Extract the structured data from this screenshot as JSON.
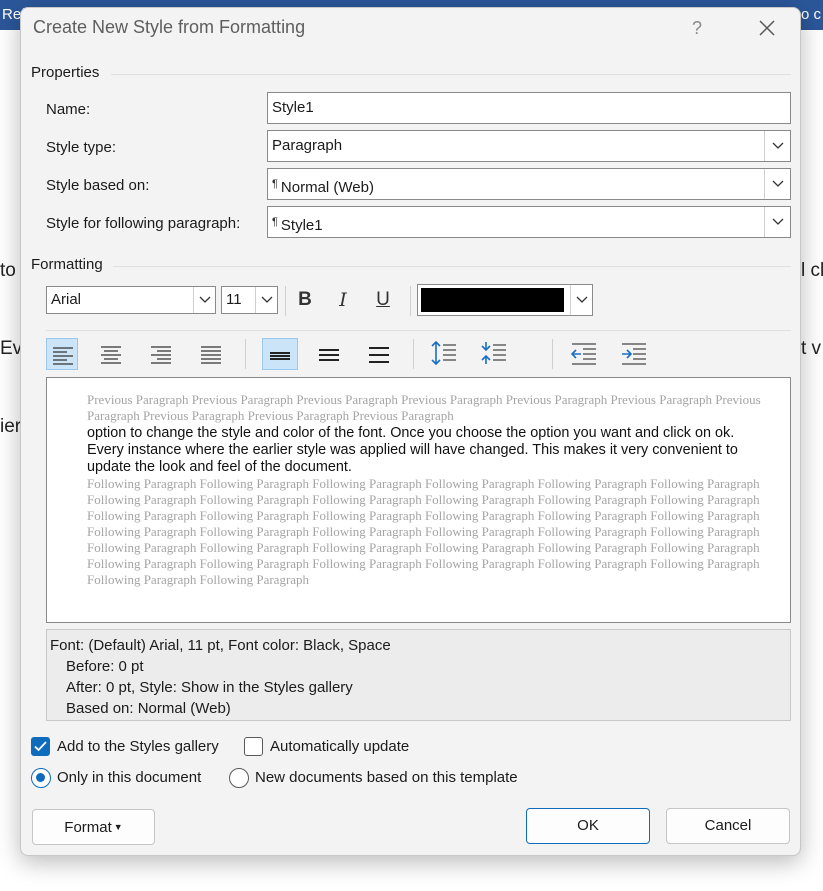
{
  "background": {
    "ribbon_left": "Ref",
    "ribbon_right": "o c",
    "side_left": [
      "to",
      "Ev",
      "ier"
    ],
    "side_right": [
      "l cl",
      "t v"
    ]
  },
  "dialog": {
    "title": "Create New Style from Formatting",
    "help": "?",
    "properties_label": "Properties",
    "name_label": "Name:",
    "name_value": "Style1",
    "style_type_label": "Style type:",
    "style_type_value": "Paragraph",
    "based_on_label": "Style based on:",
    "based_on_value": "Normal (Web)",
    "following_label": "Style for following paragraph:",
    "following_value": "Style1",
    "formatting_label": "Formatting",
    "font_name": "Arial",
    "font_size": "11",
    "bold": "B",
    "italic": "I",
    "underline": "U",
    "font_color": "#000000",
    "preview": {
      "previous": "Previous Paragraph Previous Paragraph Previous Paragraph Previous Paragraph Previous Paragraph Previous Paragraph Previous Paragraph Previous Paragraph Previous Paragraph Previous Paragraph",
      "main": "option to change the style and color of the font. Once you choose the option you want and click on ok. Every instance where the earlier style was applied will have changed. This makes it very convenient to update the look and feel of the document.",
      "following": "Following Paragraph Following Paragraph Following Paragraph Following Paragraph Following Paragraph Following Paragraph Following Paragraph Following Paragraph Following Paragraph Following Paragraph Following Paragraph Following Paragraph Following Paragraph Following Paragraph Following Paragraph Following Paragraph Following Paragraph Following Paragraph Following Paragraph Following Paragraph Following Paragraph Following Paragraph Following Paragraph Following Paragraph Following Paragraph Following Paragraph Following Paragraph Following Paragraph Following Paragraph Following Paragraph Following Paragraph Following Paragraph Following Paragraph Following Paragraph Following Paragraph Following Paragraph Following Paragraph Following Paragraph"
    },
    "description": {
      "line1": "Font: (Default) Arial, 11 pt, Font color: Black, Space",
      "line2": "Before:  0 pt",
      "line3": "After:  0 pt, Style: Show in the Styles gallery",
      "line4": "Based on: Normal (Web)"
    },
    "add_to_gallery_label": "Add to the Styles gallery",
    "add_to_gallery_checked": true,
    "auto_update_label": "Automatically update",
    "auto_update_checked": false,
    "only_this_doc_label": "Only in this document",
    "new_docs_label": "New documents based on this template",
    "format_button": "Format",
    "ok_button": "OK",
    "cancel_button": "Cancel"
  },
  "colors": {
    "accent": "#0f6cbd",
    "ribbon": "#2b579a"
  }
}
